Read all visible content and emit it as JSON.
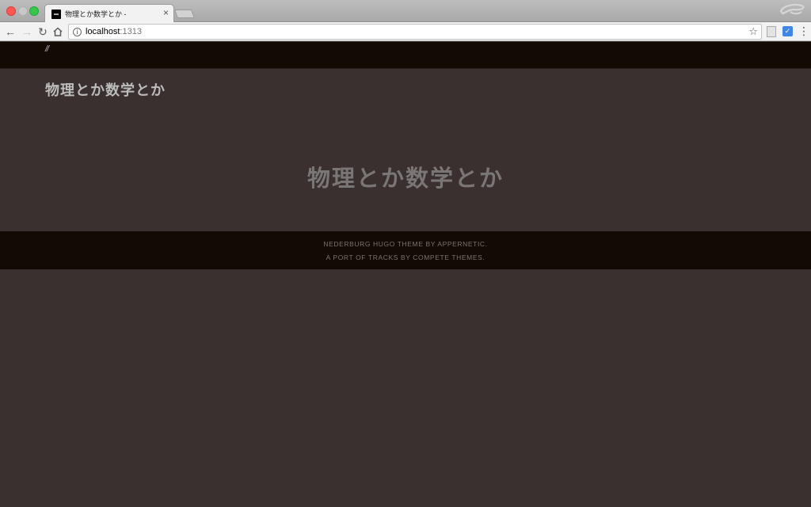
{
  "browser": {
    "tab_title": "物理とか数学とか -",
    "tab_close": "×",
    "url_host": "localhost",
    "url_port": ":1313",
    "icons": {
      "back": "arrow-left-icon",
      "forward": "arrow-right-icon",
      "reload": "reload-icon",
      "home": "home-icon",
      "info": "info-icon",
      "star": "star-icon",
      "menu": "more-vertical-icon"
    },
    "colors": {
      "close": "#fc5753",
      "minimize": "#c8c8c8",
      "maximize": "#34c84a"
    }
  },
  "page": {
    "topbar_text": "//",
    "site_title": "物理とか数学とか",
    "hero_title": "物理とか数学とか",
    "footer_line1": "NEDERBURG HUGO THEME BY APPERNETIC.",
    "footer_line2": "A PORT OF TRACKS BY COMPETE THEMES.",
    "colors": {
      "background": "#3a302f",
      "bar": "#130a04"
    }
  }
}
